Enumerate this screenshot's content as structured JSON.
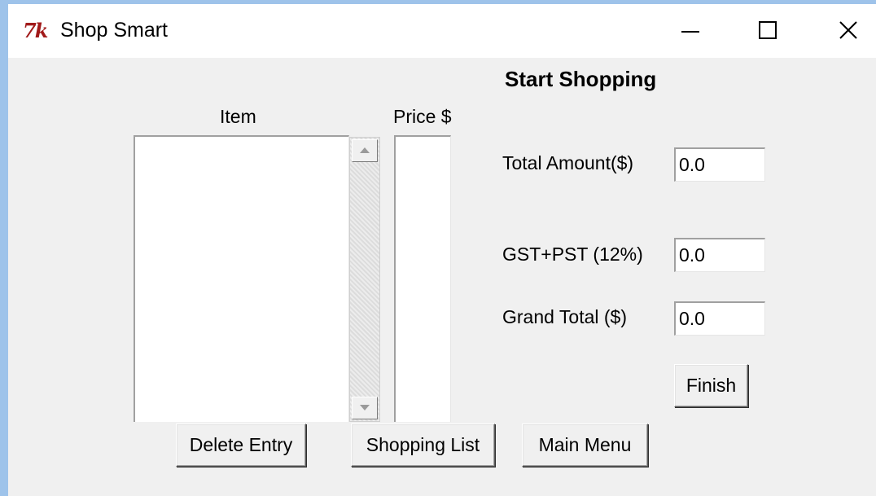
{
  "window": {
    "title": "Shop Smart",
    "icon": "tk-feather-icon",
    "controls": [
      "minimize-icon",
      "maximize-icon",
      "close-icon"
    ]
  },
  "heading": "Start Shopping",
  "item_list": {
    "header": "Item",
    "items": []
  },
  "price_list": {
    "header": "Price $",
    "items": []
  },
  "fields": {
    "total_amount": {
      "label": "Total Amount($)",
      "value": "0.0"
    },
    "tax": {
      "label": "GST+PST (12%)",
      "value": "0.0"
    },
    "grand_total": {
      "label": "Grand Total ($)",
      "value": "0.0"
    }
  },
  "buttons": {
    "finish": "Finish",
    "delete_entry": "Delete Entry",
    "shopping_list": "Shopping List",
    "main_menu": "Main Menu"
  }
}
